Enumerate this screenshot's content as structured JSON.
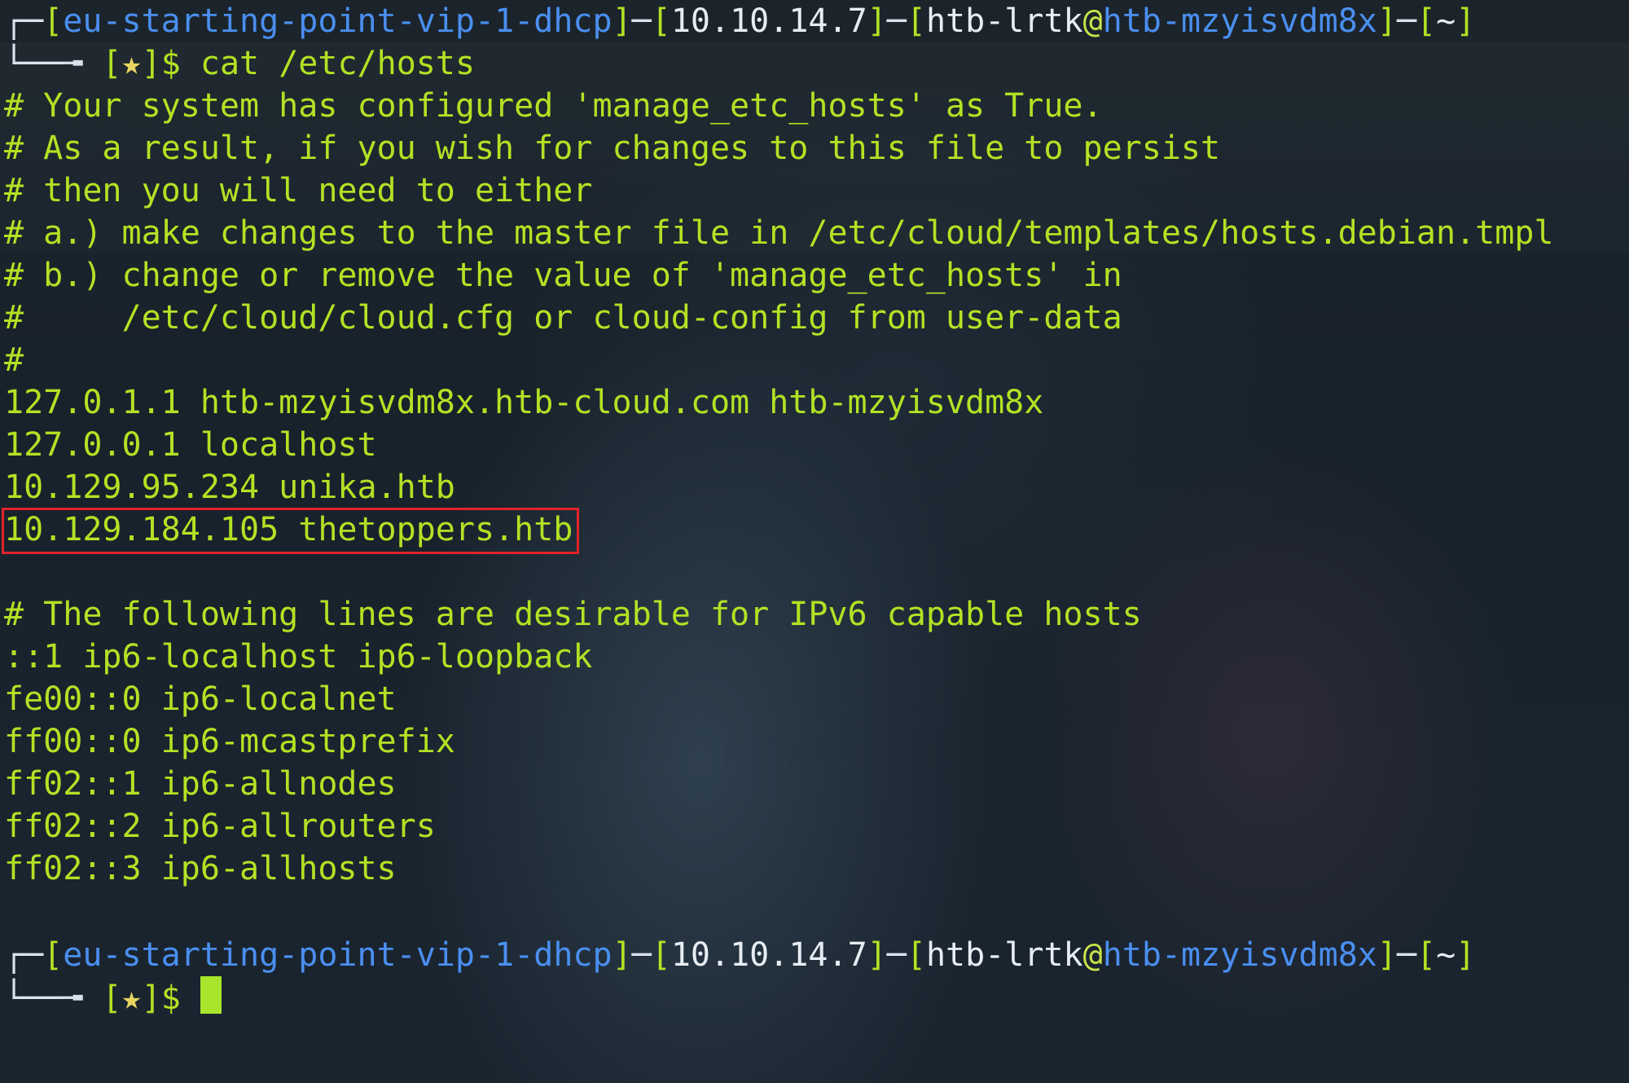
{
  "colors": {
    "background": "#151e26",
    "terminal_text": "#b2e224",
    "prompt_blue": "#4a8ff0",
    "prompt_white": "#e7edf3",
    "star": "#e8d560",
    "cursor": "#a7e42b",
    "highlight_border": "#e2232a"
  },
  "prompt_1": {
    "glyph_top": "┌─",
    "vpn": "eu-starting-point-vip-1-dhcp",
    "ip": "10.10.14.7",
    "user": "htb-lrtk",
    "at": "@",
    "host": "htb-mzyisvdm8x",
    "dir": "~",
    "glyph_bottom": "└──╼ ",
    "star": "★",
    "dollar": "$",
    "command": "cat /etc/hosts"
  },
  "output": {
    "comment_lines": [
      "# Your system has configured 'manage_etc_hosts' as True.",
      "# As a result, if you wish for changes to this file to persist",
      "# then you will need to either",
      "# a.) make changes to the master file in /etc/cloud/templates/hosts.debian.tmpl",
      "# b.) change or remove the value of 'manage_etc_hosts' in",
      "#     /etc/cloud/cloud.cfg or cloud-config from user-data",
      "#"
    ],
    "host_entries": [
      "127.0.1.1 htb-mzyisvdm8x.htb-cloud.com htb-mzyisvdm8x",
      "127.0.0.1 localhost",
      "10.129.95.234 unika.htb"
    ],
    "highlighted_entry": "10.129.184.105 thetoppers.htb",
    "ipv6_comment": "# The following lines are desirable for IPv6 capable hosts",
    "ipv6_entries": [
      "::1 ip6-localhost ip6-loopback",
      "fe00::0 ip6-localnet",
      "ff00::0 ip6-mcastprefix",
      "ff02::1 ip6-allnodes",
      "ff02::2 ip6-allrouters",
      "ff02::3 ip6-allhosts"
    ]
  },
  "prompt_2": {
    "glyph_top": "┌─",
    "vpn": "eu-starting-point-vip-1-dhcp",
    "ip": "10.10.14.7",
    "user": "htb-lrtk",
    "at": "@",
    "host": "htb-mzyisvdm8x",
    "dir": "~",
    "glyph_bottom": "└──╼ ",
    "star": "★",
    "dollar": "$"
  }
}
